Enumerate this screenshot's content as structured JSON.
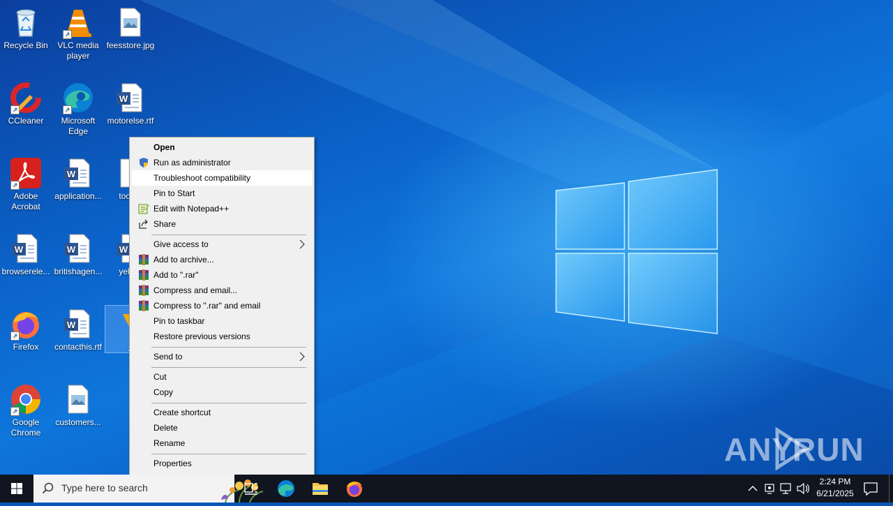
{
  "desktop": {
    "icons": [
      {
        "label": "Recycle Bin"
      },
      {
        "label": "VLC media player"
      },
      {
        "label": "feesstore.jpg"
      },
      {
        "label": "CCleaner"
      },
      {
        "label": "Microsoft Edge"
      },
      {
        "label": "motorelse.rtf"
      },
      {
        "label": "Adobe Acrobat"
      },
      {
        "label": "application..."
      },
      {
        "label": "tookre"
      },
      {
        "label": "browserele..."
      },
      {
        "label": "britishagen..."
      },
      {
        "label": "yellow"
      },
      {
        "label": "Firefox"
      },
      {
        "label": "contacthis.rtf"
      },
      {
        "label": ".e"
      },
      {
        "label": "Google Chrome"
      },
      {
        "label": "customers..."
      }
    ]
  },
  "context_menu": {
    "items": [
      {
        "label": "Open",
        "bold": true
      },
      {
        "label": "Run as administrator",
        "icon": "uac-shield-icon"
      },
      {
        "label": "Troubleshoot compatibility",
        "highlighted": true
      },
      {
        "label": "Pin to Start"
      },
      {
        "label": "Edit with Notepad++",
        "icon": "notepadpp-icon"
      },
      {
        "label": "Share",
        "icon": "share-icon"
      },
      {
        "label": "Give access to",
        "submenu": true
      },
      {
        "label": "Add to archive...",
        "icon": "winrar-icon"
      },
      {
        "label": "Add to \".rar\"",
        "icon": "winrar-icon"
      },
      {
        "label": "Compress and email...",
        "icon": "winrar-icon"
      },
      {
        "label": "Compress to \".rar\" and email",
        "icon": "winrar-icon"
      },
      {
        "label": "Pin to taskbar"
      },
      {
        "label": "Restore previous versions"
      },
      {
        "label": "Send to",
        "submenu": true
      },
      {
        "label": "Cut"
      },
      {
        "label": "Copy"
      },
      {
        "label": "Create shortcut"
      },
      {
        "label": "Delete"
      },
      {
        "label": "Rename"
      },
      {
        "label": "Properties"
      }
    ],
    "submenu_arrow": ">"
  },
  "taskbar": {
    "search_placeholder": "Type here to search",
    "clock_time": "2:24 PM",
    "clock_date": "6/21/2025"
  },
  "watermark": "ANY RUN",
  "colors": {
    "taskbar": "#10151f",
    "menu_bg": "#f0f0f0",
    "menu_hover": "#ffffff",
    "wallpaper_blue": "#0b63c9"
  }
}
